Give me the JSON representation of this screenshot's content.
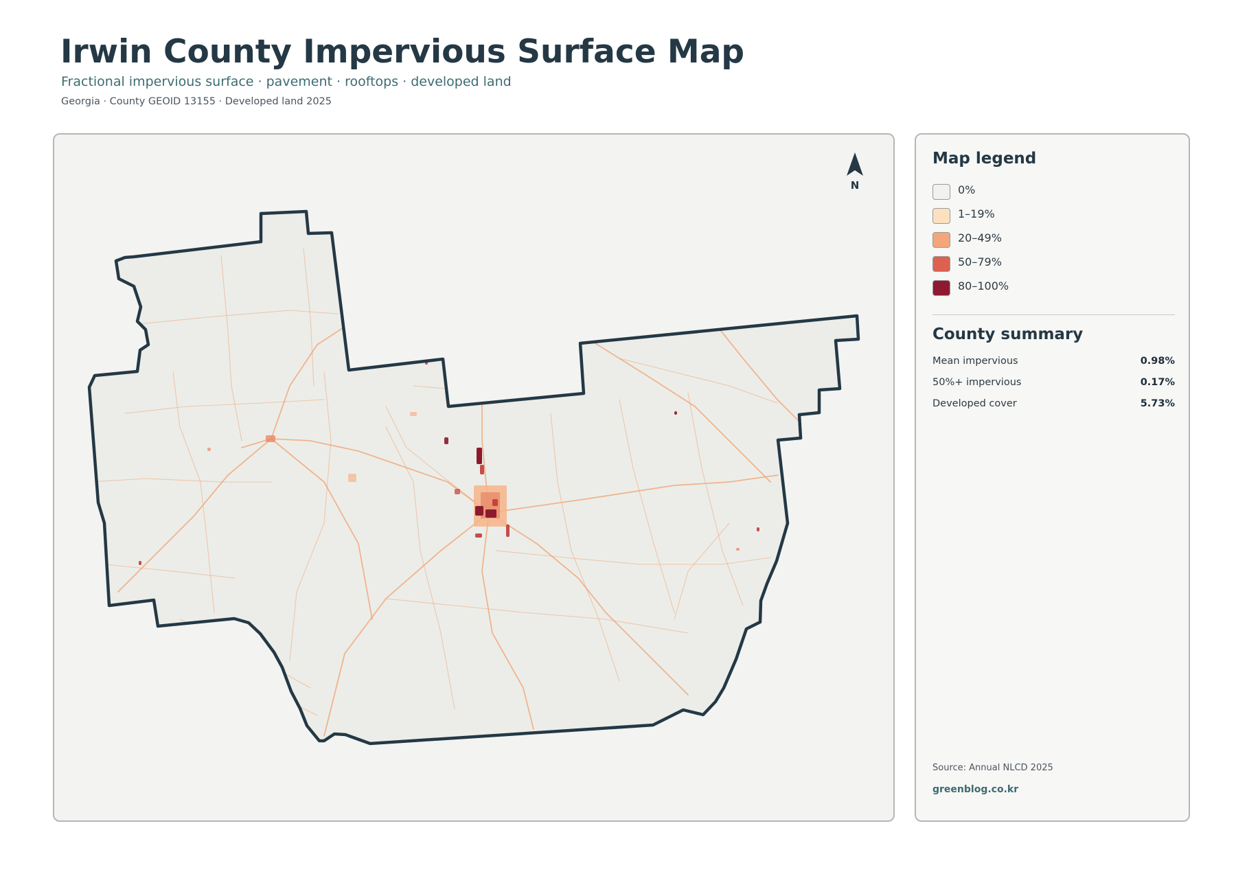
{
  "header": {
    "title": "Irwin County Impervious Surface Map",
    "subtitle": "Fractional impervious surface · pavement · rooftops · developed land",
    "meta": "Georgia · County GEOID 13155 · Developed land 2025"
  },
  "map": {
    "north_label": "N",
    "north_icon": "north-arrow-icon",
    "colors": {
      "land": "#ecede8",
      "boundary": "#243845",
      "roads": "#f0a070",
      "developed": "#8b1a2e"
    }
  },
  "legend": {
    "title": "Map legend",
    "items": [
      {
        "label": "0%",
        "color": "#f1f1ee"
      },
      {
        "label": "1–19%",
        "color": "#fde0bf"
      },
      {
        "label": "20–49%",
        "color": "#f5a57a"
      },
      {
        "label": "50–79%",
        "color": "#de6050"
      },
      {
        "label": "80–100%",
        "color": "#8f1a30"
      }
    ]
  },
  "summary": {
    "title": "County summary",
    "stats": [
      {
        "label": "Mean impervious",
        "value": "0.98%"
      },
      {
        "label": "50%+ impervious",
        "value": "0.17%"
      },
      {
        "label": "Developed cover",
        "value": "5.73%"
      }
    ]
  },
  "footer": {
    "source": "Source: Annual NLCD 2025",
    "credit": "greenblog.co.kr"
  }
}
